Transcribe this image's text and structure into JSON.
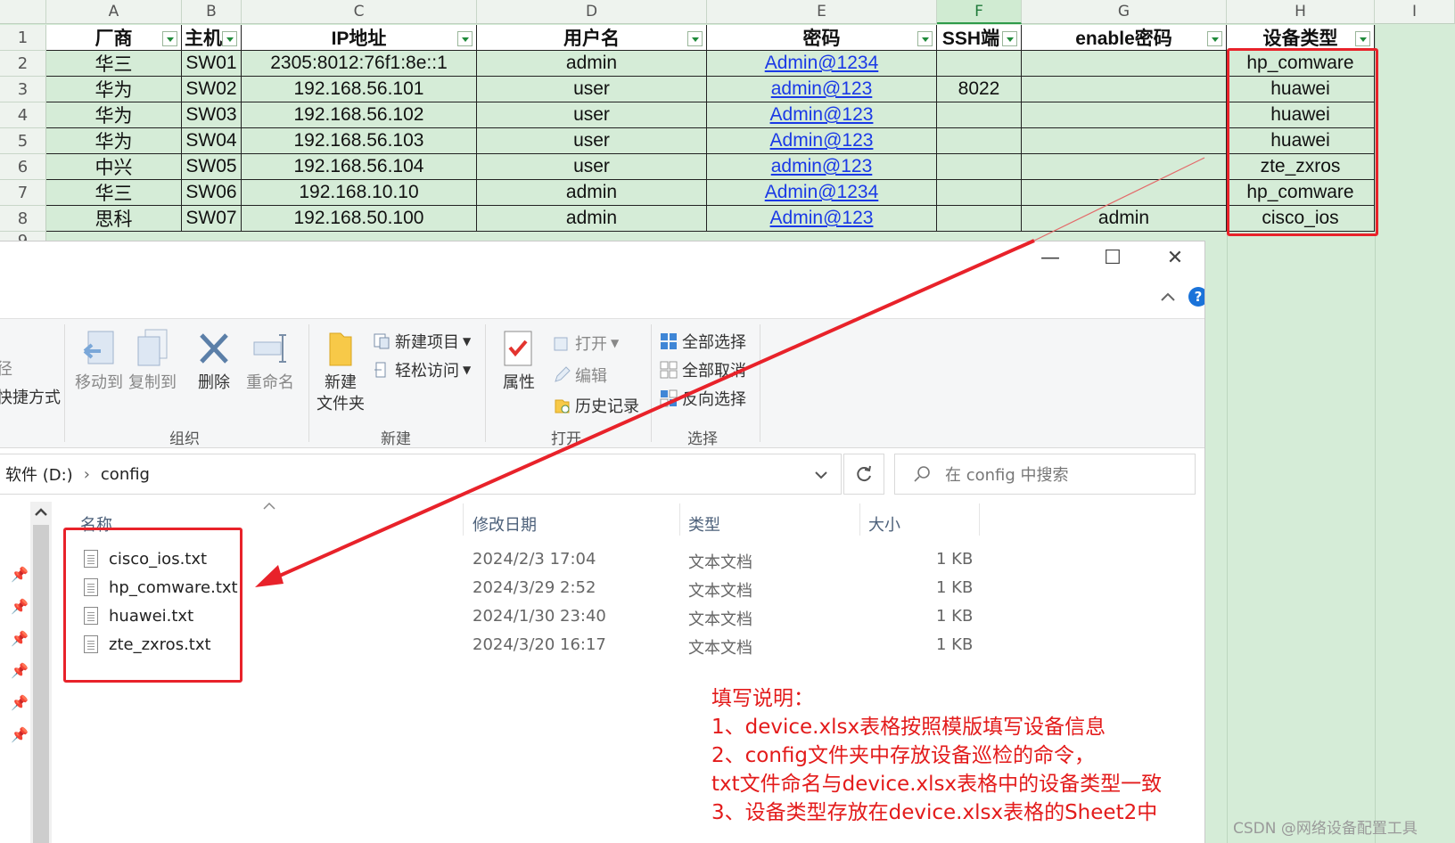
{
  "spreadsheet": {
    "column_letters": [
      "A",
      "B",
      "C",
      "D",
      "E",
      "F",
      "G",
      "H",
      "I"
    ],
    "selected_column": "F",
    "row_numbers": [
      "1",
      "2",
      "3",
      "4",
      "5",
      "6",
      "7",
      "8",
      "9"
    ],
    "headers": [
      "厂商",
      "主机",
      "IP地址",
      "用户名",
      "密码",
      "SSH端",
      "enable密码",
      "设备类型"
    ],
    "rows": [
      [
        "华三",
        "SW01",
        "2305:8012:76f1:8e::1",
        "admin",
        "Admin@1234",
        "",
        "",
        "hp_comware"
      ],
      [
        "华为",
        "SW02",
        "192.168.56.101",
        "user",
        "admin@123",
        "8022",
        "",
        "huawei"
      ],
      [
        "华为",
        "SW03",
        "192.168.56.102",
        "user",
        "Admin@123",
        "",
        "",
        "huawei"
      ],
      [
        "华为",
        "SW04",
        "192.168.56.103",
        "user",
        "Admin@123",
        "",
        "",
        "huawei"
      ],
      [
        "中兴",
        "SW05",
        "192.168.56.104",
        "user",
        "admin@123",
        "",
        "",
        "zte_zxros"
      ],
      [
        "华三",
        "SW06",
        "192.168.10.10",
        "admin",
        "Admin@1234",
        "",
        "",
        "hp_comware"
      ],
      [
        "思科",
        "SW07",
        "192.168.50.100",
        "admin",
        "Admin@123",
        "",
        "admin",
        "cisco_ios"
      ]
    ]
  },
  "explorer": {
    "window_controls": {
      "minimize": "—",
      "maximize": "☐",
      "close": "✕"
    },
    "ribbon": {
      "left_partial": [
        "径",
        "快捷方式"
      ],
      "organize": {
        "label": "组织",
        "move_to": "移动到",
        "copy_to": "复制到",
        "delete": "删除",
        "rename": "重命名"
      },
      "new": {
        "label": "新建",
        "new_folder": "新建\n文件夹",
        "new_item": "新建项目",
        "easy_access": "轻松访问"
      },
      "open": {
        "label": "打开",
        "properties": "属性",
        "open": "打开",
        "edit": "编辑",
        "history": "历史记录"
      },
      "select": {
        "label": "选择",
        "select_all": "全部选择",
        "select_none": "全部取消",
        "invert": "反向选择"
      }
    },
    "address": {
      "drive": "软件 (D:)",
      "folder": "config",
      "separator": "›"
    },
    "search_placeholder": "在 config 中搜索",
    "columns": {
      "name": "名称",
      "modified": "修改日期",
      "type": "类型",
      "size": "大小"
    },
    "files": [
      {
        "name": "cisco_ios.txt",
        "modified": "2024/2/3 17:04",
        "type": "文本文档",
        "size": "1 KB"
      },
      {
        "name": "hp_comware.txt",
        "modified": "2024/3/29 2:52",
        "type": "文本文档",
        "size": "1 KB"
      },
      {
        "name": "huawei.txt",
        "modified": "2024/1/30 23:40",
        "type": "文本文档",
        "size": "1 KB"
      },
      {
        "name": "zte_zxros.txt",
        "modified": "2024/3/20 16:17",
        "type": "文本文档",
        "size": "1 KB"
      }
    ]
  },
  "notes": {
    "title": "填写说明：",
    "lines": [
      "1、device.xlsx表格按照模版填写设备信息",
      "2、config文件夹中存放设备巡检的命令，",
      "txt文件命名与device.xlsx表格中的设备类型一致",
      "3、设备类型存放在device.xlsx表格的Sheet2中"
    ]
  },
  "watermark": "CSDN @网络设备配置工具",
  "colors": {
    "annotation_red": "#e8222a",
    "sheet_green": "#d5ecd7",
    "link_blue": "#1a39e6"
  }
}
